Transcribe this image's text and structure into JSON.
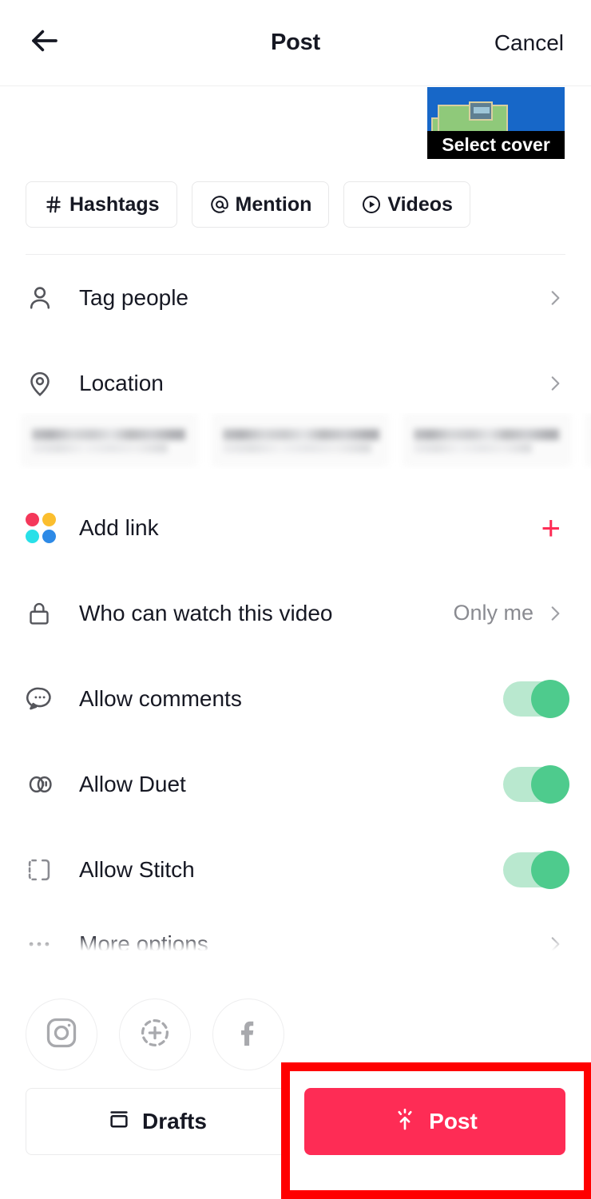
{
  "header": {
    "back_icon": "arrow-left-icon",
    "title": "Post",
    "cancel_label": "Cancel"
  },
  "caption": {
    "value": "",
    "placeholder": ""
  },
  "cover": {
    "label": "Select cover"
  },
  "chips": [
    {
      "icon": "hashtag-icon",
      "label": "Hashtags"
    },
    {
      "icon": "at-mention-icon",
      "label": "Mention"
    },
    {
      "icon": "play-circle-icon",
      "label": "Videos"
    }
  ],
  "rows": {
    "tag_people": {
      "icon": "person-icon",
      "label": "Tag people",
      "chevron": "chevron-right-icon"
    },
    "location": {
      "icon": "location-pin-icon",
      "label": "Location",
      "chevron": "chevron-right-icon"
    },
    "add_link": {
      "icon": "four-color-dots-icon",
      "label": "Add link",
      "action": "+"
    },
    "privacy": {
      "icon": "lock-icon",
      "label": "Who can watch this video",
      "value": "Only me",
      "chevron": "chevron-right-icon"
    },
    "allow_comments": {
      "icon": "comment-bubble-icon",
      "label": "Allow comments",
      "enabled": true
    },
    "allow_duet": {
      "icon": "duet-icon",
      "label": "Allow Duet",
      "enabled": true
    },
    "allow_stitch": {
      "icon": "stitch-icon",
      "label": "Allow Stitch",
      "enabled": true
    },
    "more_options": {
      "icon": "ellipsis-icon",
      "label": "More options",
      "chevron": "chevron-right-icon"
    }
  },
  "location_suggestions": [
    {
      "redacted": true
    },
    {
      "redacted": true
    },
    {
      "redacted": true
    },
    {
      "redacted": true
    }
  ],
  "share": [
    {
      "icon": "instagram-icon",
      "name": "Instagram"
    },
    {
      "icon": "instagram-story-icon",
      "name": "Instagram Story"
    },
    {
      "icon": "facebook-icon",
      "name": "Facebook"
    }
  ],
  "footer": {
    "drafts_label": "Drafts",
    "drafts_icon": "drafts-box-icon",
    "post_label": "Post",
    "post_icon": "publish-burst-icon"
  },
  "colors": {
    "accent": "#fe2c55",
    "toggle_on_track": "#b9e8cf",
    "toggle_on_knob": "#4ecb8d",
    "text_primary": "#161823",
    "text_secondary": "#8a8b91",
    "annotation": "#ff0000",
    "cover_water": "#1767c8",
    "cover_land": "#8fc97a"
  }
}
